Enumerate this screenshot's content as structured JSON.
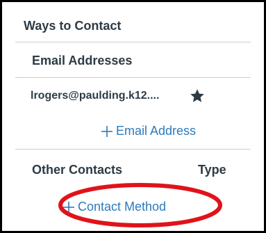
{
  "section": {
    "title": "Ways to Contact"
  },
  "email_addresses": {
    "title": "Email Addresses",
    "items": [
      {
        "address": "lrogers@paulding.k12....",
        "default_icon": "star-icon"
      }
    ],
    "add_label": "Email Address",
    "add_icon": "plus-icon"
  },
  "other_contacts": {
    "title": "Other Contacts",
    "type_header": "Type",
    "add_label": "Contact Method",
    "add_icon": "plus-icon"
  },
  "colors": {
    "text": "#2d3b45",
    "link": "#2b7abc",
    "divider": "#c7cdd1",
    "annotation": "#e0131a",
    "frame": "#000000"
  }
}
